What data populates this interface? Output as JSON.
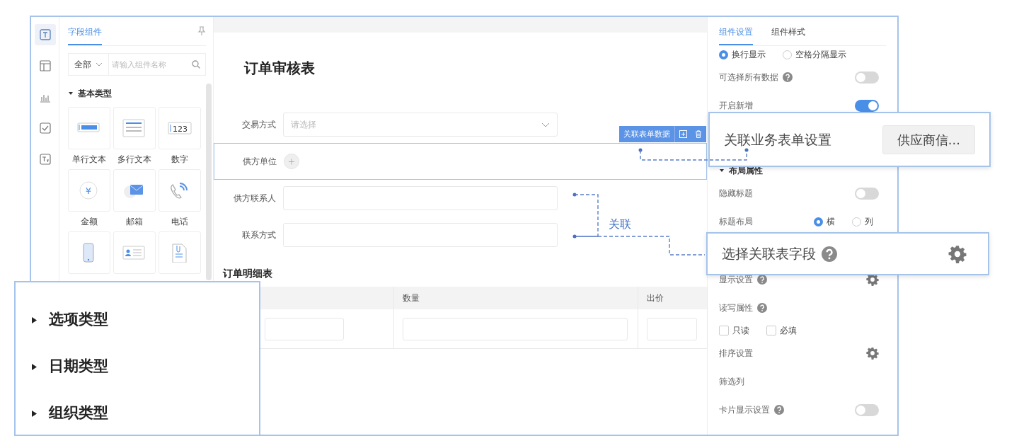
{
  "rail_items": [
    {
      "kind": "text",
      "selected": true
    },
    {
      "kind": "layout",
      "selected": false
    },
    {
      "kind": "chart",
      "selected": false
    },
    {
      "kind": "check",
      "selected": false
    },
    {
      "kind": "style",
      "selected": false
    }
  ],
  "left_panel": {
    "tab": "字段组件",
    "filter": "全部",
    "search": {
      "placeholder": "请输入组件名称"
    },
    "group": {
      "label": "基本类型",
      "expanded": true,
      "items": [
        {
          "kind": "single-line",
          "label": "单行文本"
        },
        {
          "kind": "multi-line",
          "label": "多行文本"
        },
        {
          "kind": "number",
          "label": "数字",
          "icon_text": "123"
        },
        {
          "kind": "money",
          "label": "金额",
          "icon_text": "¥"
        },
        {
          "kind": "mail",
          "label": "邮箱"
        },
        {
          "kind": "phone",
          "label": "电话"
        },
        {
          "kind": "mobile"
        },
        {
          "kind": "id-card"
        },
        {
          "kind": "attachment"
        }
      ]
    }
  },
  "category_overlay": {
    "items": [
      {
        "label": "选项类型",
        "expanded": false
      },
      {
        "label": "日期类型",
        "expanded": false
      },
      {
        "label": "组织类型",
        "expanded": false
      }
    ]
  },
  "form": {
    "title": "订单审核表",
    "fields": [
      {
        "kind": "select",
        "label": "交易方式",
        "placeholder": "请选择",
        "selected": false
      },
      {
        "kind": "add",
        "label": "供方单位",
        "selected": true
      },
      {
        "kind": "input",
        "label": "供方联系人",
        "selected": false
      },
      {
        "kind": "input",
        "label": "联系方式",
        "selected": false
      }
    ],
    "toolbar": {
      "label": "关联表单数据"
    },
    "link_label": "关联",
    "subtable": {
      "title": "订单明细表",
      "columns": [
        {
          "label": "数量"
        },
        {
          "label": "出价"
        }
      ]
    }
  },
  "settings": {
    "tabs": [
      {
        "label": "组件设置",
        "selected": true
      },
      {
        "label": "组件样式",
        "selected": false
      }
    ],
    "rows": [
      {
        "kind": "radios",
        "options": [
          {
            "label": "换行显示",
            "selected": true
          },
          {
            "label": "空格分隔显示",
            "selected": false
          }
        ]
      },
      {
        "kind": "toggle",
        "label": "可选择所有数据",
        "help": true,
        "on": false
      },
      {
        "kind": "toggle",
        "label": "开启新增",
        "on": true
      },
      {
        "kind": "section",
        "label": "布局属性",
        "expanded": true
      },
      {
        "kind": "toggle",
        "label": "隐藏标题",
        "on": false
      },
      {
        "kind": "radio-row",
        "label": "标题布局",
        "options": [
          {
            "label": "横",
            "selected": true
          },
          {
            "label": "列",
            "selected": false
          }
        ]
      },
      {
        "kind": "gear",
        "label": "显示设置",
        "help": true
      },
      {
        "kind": "label",
        "label": "读写属性",
        "help": true
      },
      {
        "kind": "checkboxes",
        "options": [
          {
            "label": "只读",
            "checked": false
          },
          {
            "label": "必填",
            "checked": false
          }
        ]
      },
      {
        "kind": "gear",
        "label": "排序设置"
      },
      {
        "kind": "label",
        "label": "筛选列"
      },
      {
        "kind": "toggle",
        "label": "卡片显示设置",
        "help": true,
        "on": false
      }
    ]
  },
  "callouts": [
    {
      "kind": "button",
      "title": "关联业务表单设置",
      "button": "供应商信..."
    },
    {
      "kind": "gear",
      "title": "选择关联表字段",
      "help": true
    }
  ]
}
